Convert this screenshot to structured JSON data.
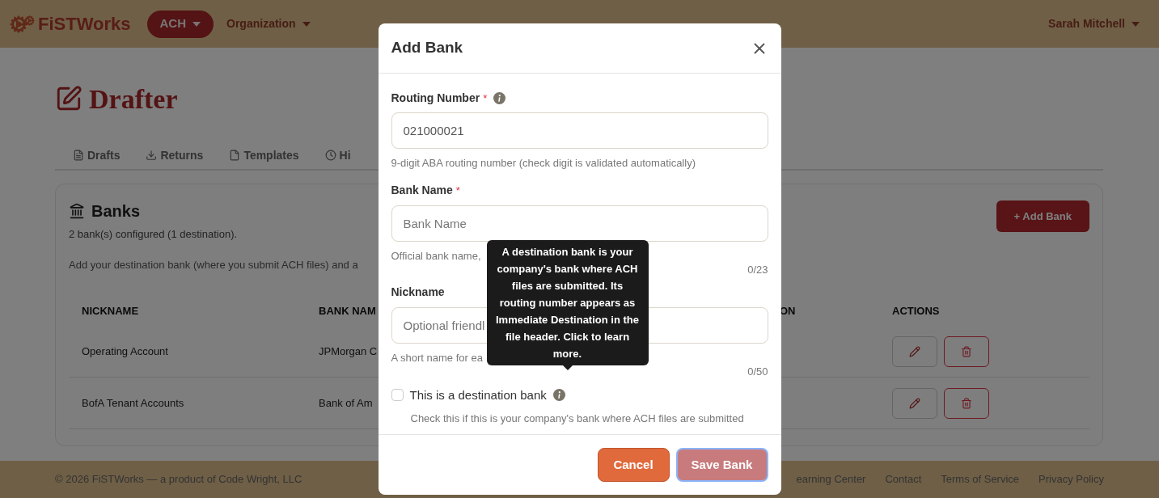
{
  "header": {
    "brand": "FiSTWorks",
    "module_menu": "ACH",
    "nav_menu": "Organization",
    "user_menu": "Sarah Mitchell"
  },
  "page": {
    "title": "Drafter",
    "tabs": [
      {
        "label": "Drafts",
        "selected": false
      },
      {
        "label": "Returns",
        "selected": false
      },
      {
        "label": "Templates",
        "selected": false
      },
      {
        "label": "Hi",
        "selected": false
      }
    ]
  },
  "banks_card": {
    "title": "Banks",
    "summary": "2 bank(s) configured (1 destination).",
    "description": "Add your destination bank (where you submit ACH files) and a",
    "add_button": "+ Add Bank",
    "table": {
      "columns": [
        "NICKNAME",
        "BANK NAM",
        "ON",
        "ACTIONS"
      ],
      "rows": [
        {
          "cells": [
            "Operating Account",
            "JPMorgan C"
          ]
        },
        {
          "cells": [
            "BofA Tenant Accounts",
            "Bank of Am"
          ]
        }
      ]
    }
  },
  "footer": {
    "copyright": "© 2026 FiSTWorks — a product of Code Wright, LLC",
    "links": [
      "earning Center",
      "Contact",
      "Terms of Service",
      "Privacy Policy"
    ]
  },
  "modal": {
    "title": "Add Bank",
    "fields": [
      {
        "label": "Routing Number",
        "required_mark": "*",
        "info": true,
        "value": "021000021",
        "help": "9-digit ABA routing number (check digit is validated automatically)"
      },
      {
        "label": "Bank Name",
        "required_mark": "*",
        "info": false,
        "placeholder": "Bank Name",
        "help": "Official bank name,",
        "counter": "0/23"
      },
      {
        "label": "Nickname",
        "info": false,
        "placeholder": "Optional friendl",
        "help": "A short name for ea",
        "counter": "0/50"
      }
    ],
    "checkbox": {
      "label": "This is a destination bank",
      "checked": false,
      "help": "Check this if this is your company's bank where ACH files are submitted"
    },
    "tooltip": "A destination bank is your company's bank where ACH files are submitted. Its routing number appears as Immediate Destination in the file header. Click to learn more.",
    "buttons": [
      {
        "label": "Cancel",
        "kind": "secondary"
      },
      {
        "label": "Save Bank",
        "kind": "primary"
      }
    ]
  }
}
